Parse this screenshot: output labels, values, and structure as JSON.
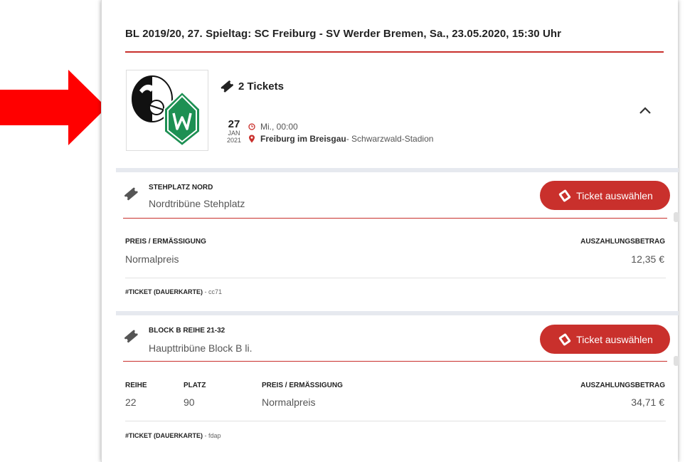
{
  "event_title": "BL 2019/20, 27. Spieltag: SC Freiburg - SV Werder Bremen, Sa., 23.05.2020, 15:30 Uhr",
  "tickets_count_label": "2 Tickets",
  "date": {
    "day": "27",
    "month": "JAN",
    "year": "2021"
  },
  "time_label": "Mi., 00:00",
  "location": {
    "city": "Freiburg im Breisgau",
    "venue": " - Schwarzwald-Stadion"
  },
  "colors": {
    "accent": "#c9302c",
    "arrow": "#ff0000",
    "divider": "#e6e9ef"
  },
  "icons": [
    "ticket-icon",
    "clock-icon",
    "map-pin-icon",
    "chevron-up-icon",
    "hand-ticket-icon",
    "arrow-right-icon"
  ],
  "tickets": [
    {
      "section_label": "STEHPLATZ NORD",
      "section_value": "Nordtribüne Stehplatz",
      "button_label": "Ticket auswählen",
      "price_head": "PREIS / ERMÄSSIGUNG",
      "price_value": "Normalpreis",
      "payout_head": "AUSZAHLUNGSBETRAG",
      "payout_value": "12,35 €",
      "footer_label": "#TICKET (DAUERKARTE)",
      "footer_code": " - cc71"
    },
    {
      "section_label": "BLOCK B REIHE 21-32",
      "section_value": "Haupttribüne Block B li.",
      "button_label": "Ticket auswählen",
      "row_head": "REIHE",
      "row_value": "22",
      "seat_head": "PLATZ",
      "seat_value": "90",
      "price_head": "PREIS / ERMÄSSIGUNG",
      "price_value": "Normalpreis",
      "payout_head": "AUSZAHLUNGSBETRAG",
      "payout_value": "34,71 €",
      "footer_label": "#TICKET (DAUERKARTE)",
      "footer_code": " - fdap"
    }
  ]
}
